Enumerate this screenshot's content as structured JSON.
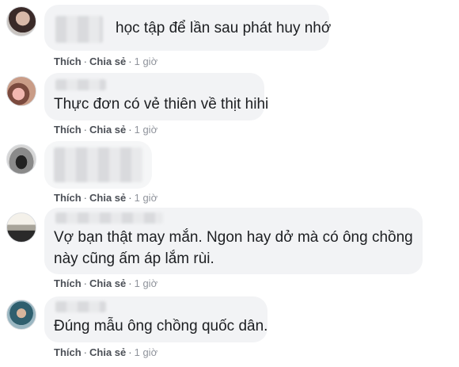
{
  "comments": [
    {
      "text_lines": [
        "học tập để lần sau phát huy nhớ"
      ],
      "like": "Thích",
      "share": "Chia sẻ",
      "sep": "·",
      "time": "1 giờ"
    },
    {
      "text_lines": [
        "Thực đơn có vẻ thiên về thịt hihi"
      ],
      "like": "Thích",
      "share": "Chia sẻ",
      "sep": "·",
      "time": "1 giờ"
    },
    {
      "text_lines": [
        ""
      ],
      "like": "Thích",
      "share": "Chia sẻ",
      "sep": "·",
      "time": "1 giờ"
    },
    {
      "text_lines": [
        "Vợ bạn thật may mắn. Ngon hay dở mà có ông chồng",
        "này cũng ấm áp lắm rùi."
      ],
      "like": "Thích",
      "share": "Chia sẻ",
      "sep": "·",
      "time": "1 giờ"
    },
    {
      "text_lines": [
        "Đúng mẫu ông chồng quốc dân."
      ],
      "like": "Thích",
      "share": "Chia sẻ",
      "sep": "·",
      "time": "1 giờ"
    }
  ]
}
